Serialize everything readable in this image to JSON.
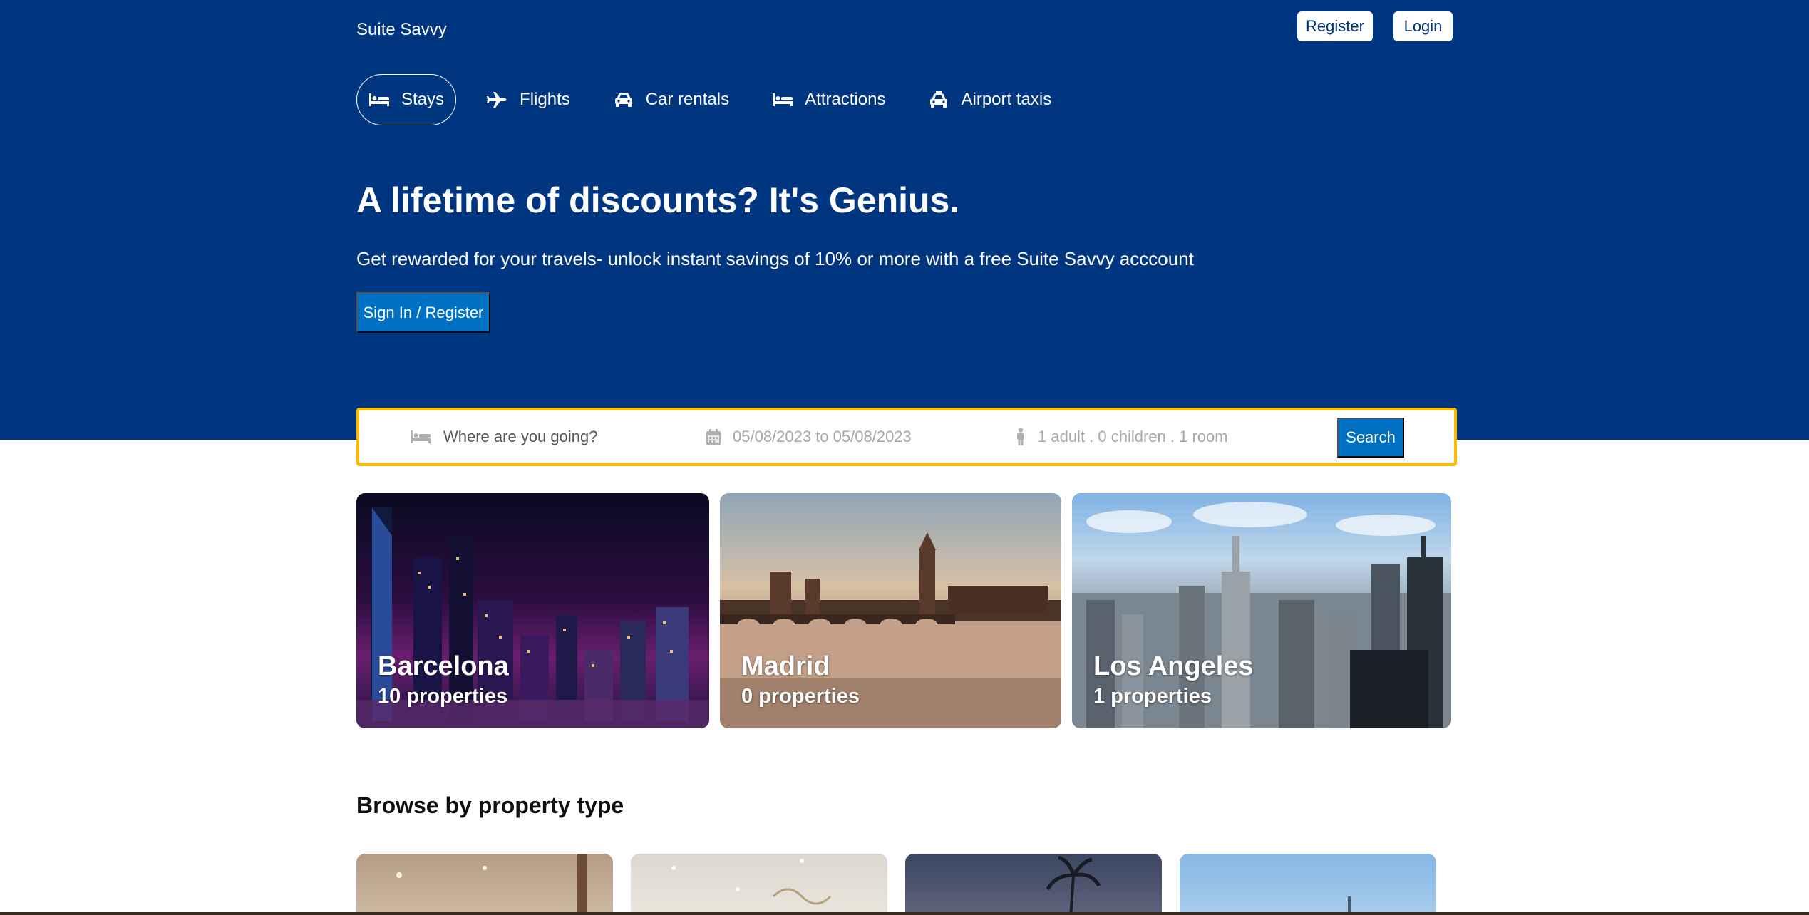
{
  "brand": "Suite Savvy",
  "auth": {
    "register": "Register",
    "login": "Login"
  },
  "nav": [
    {
      "label": "Stays",
      "icon": "bed-icon",
      "active": true
    },
    {
      "label": "Flights",
      "icon": "plane-icon",
      "active": false
    },
    {
      "label": "Car rentals",
      "icon": "car-icon",
      "active": false
    },
    {
      "label": "Attractions",
      "icon": "bed-icon",
      "active": false
    },
    {
      "label": "Airport taxis",
      "icon": "taxi-icon",
      "active": false
    }
  ],
  "hero": {
    "title": "A lifetime of discounts? It's Genius.",
    "subtitle": "Get rewarded for your travels- unlock instant savings of 10% or more with a free Suite Savvy acccount",
    "cta": "Sign In / Register"
  },
  "search": {
    "destination_placeholder": "Where are you going?",
    "dates": "05/08/2023 to 05/08/2023",
    "guests": "1 adult . 0 children . 1 room",
    "button": "Search"
  },
  "cities": [
    {
      "name": "Barcelona",
      "properties": "10 properties"
    },
    {
      "name": "Madrid",
      "properties": "0 properties"
    },
    {
      "name": "Los Angeles",
      "properties": "1 properties"
    }
  ],
  "property_section": {
    "title": "Browse by property type"
  },
  "colors": {
    "header_bg": "#003580",
    "primary_button": "#0071c2",
    "search_border": "#febb02"
  }
}
